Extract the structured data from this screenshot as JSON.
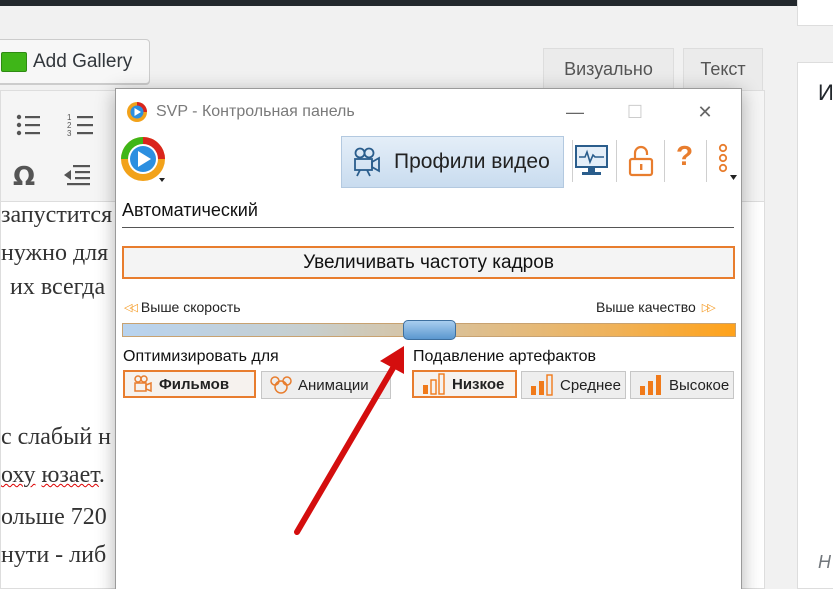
{
  "editor": {
    "add_gallery_label": "Add Gallery",
    "tabs": [
      "Визуально",
      "Текст"
    ],
    "toolbar_icons": [
      "bullet-list-icon",
      "numbered-list-icon",
      "omega-icon",
      "outdent-icon"
    ],
    "body_lines": [
      {
        "text": "запустится"
      },
      {
        "text": "нужно для"
      },
      {
        "text": "их всегда"
      },
      {
        "text": "с слабый н"
      },
      {
        "text": "оху юзает."
      },
      {
        "text": "ольше 720"
      },
      {
        "text": "нути - либ"
      }
    ],
    "side_heading": "И",
    "side_footer": "Н"
  },
  "svp": {
    "title": "SVP - Контрольная панель",
    "window_buttons": {
      "minimize": "—",
      "maximize": "☐",
      "close": "✕"
    },
    "active_tab": "Профили видео",
    "toolbar_icons": [
      "monitor-icon",
      "unlock-icon",
      "help-icon",
      "more-icon"
    ],
    "help_glyph": "?",
    "preset_name": "Автоматический",
    "fps_button": "Увеличивать частоту кадров",
    "slider": {
      "left_label": "Выше скорость",
      "right_label": "Выше качество",
      "position": 0.45
    },
    "optimize": {
      "label": "Оптимизировать для",
      "options": [
        {
          "label": "Фильмов",
          "active": true
        },
        {
          "label": "Анимации",
          "active": false
        }
      ]
    },
    "artifacts": {
      "label": "Подавление артефактов",
      "options": [
        {
          "label": "Низкое",
          "active": true
        },
        {
          "label": "Среднее",
          "active": false
        },
        {
          "label": "Высокое",
          "active": false
        }
      ]
    }
  },
  "colors": {
    "accent_orange": "#e87d2e",
    "annotation_arrow": "#d40e0e",
    "tab_blue": "#c9dcef"
  }
}
